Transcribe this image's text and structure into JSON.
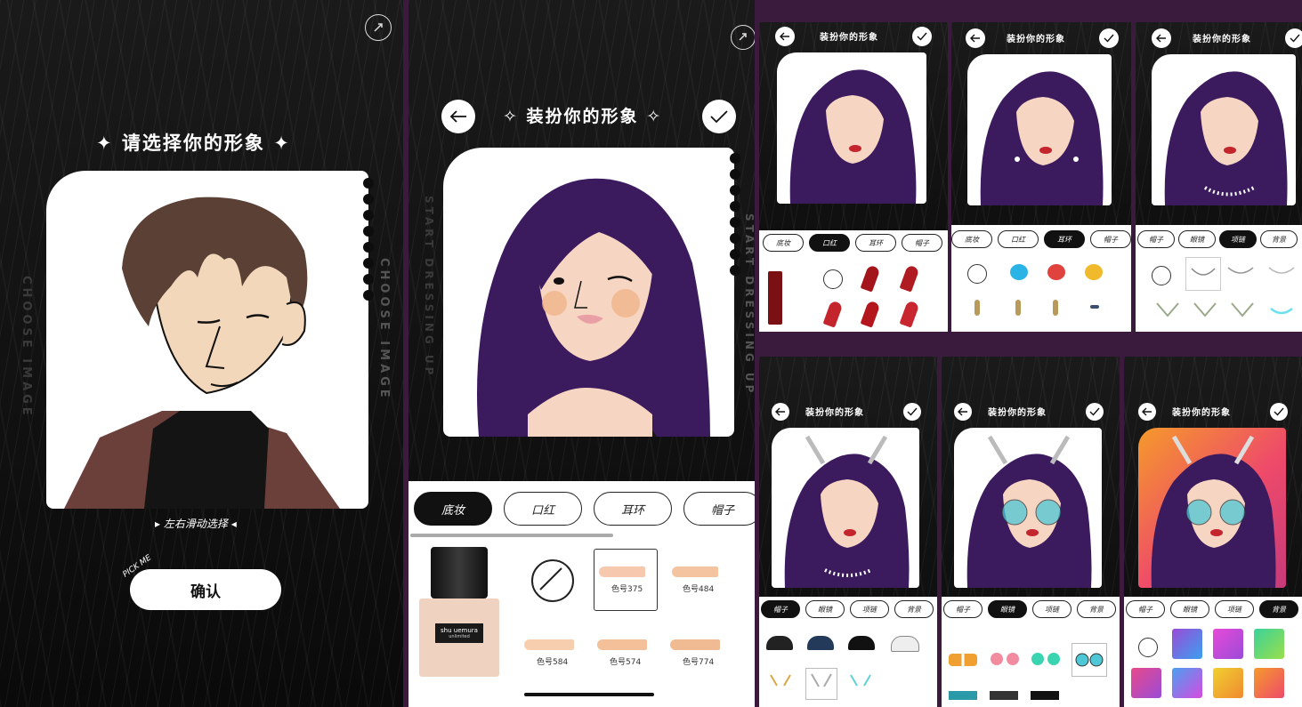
{
  "panel1": {
    "title": "请选择你的形象",
    "vertical_label": "CHOOSE IMAGE",
    "swipe_hint": "左右滑动选择",
    "pick_me": "PICK ME",
    "confirm_label": "确认"
  },
  "panel2": {
    "title": "装扮你的形象",
    "vertical_label": "START DRESSING UP",
    "tabs": [
      "底妆",
      "口红",
      "耳环",
      "帽子"
    ],
    "active_tab": "底妆",
    "product_brand": "shu uemura",
    "product_name": "unlimited",
    "shades": [
      "色号375",
      "色号484",
      "色号584",
      "色号574",
      "色号774"
    ]
  },
  "mini_title": "装扮你的形象",
  "mini_top": [
    {
      "tabs": [
        "底妆",
        "口红",
        "耳环",
        "帽子"
      ],
      "active": "口红"
    },
    {
      "tabs": [
        "底妆",
        "口红",
        "耳环",
        "帽子"
      ],
      "active": "耳环"
    },
    {
      "tabs": [
        "帽子",
        "眼镜",
        "项链",
        "背景"
      ],
      "active": "项链"
    }
  ],
  "mini_bottom": [
    {
      "tabs": [
        "帽子",
        "眼镜",
        "项链",
        "背景"
      ],
      "active": "帽子"
    },
    {
      "tabs": [
        "帽子",
        "眼镜",
        "项链",
        "背景"
      ],
      "active": "眼镜"
    },
    {
      "tabs": [
        "帽子",
        "眼镜",
        "项链",
        "背景"
      ],
      "active": "背景"
    }
  ],
  "colors": {
    "accent_pink": "#e23bd0",
    "accent_cyan": "#35d2e8",
    "hair_purple": "#3b1a5e",
    "lip_red": "#c4242b",
    "skin": "#f6d5c2",
    "bg_purple": "#3a1b3e"
  }
}
